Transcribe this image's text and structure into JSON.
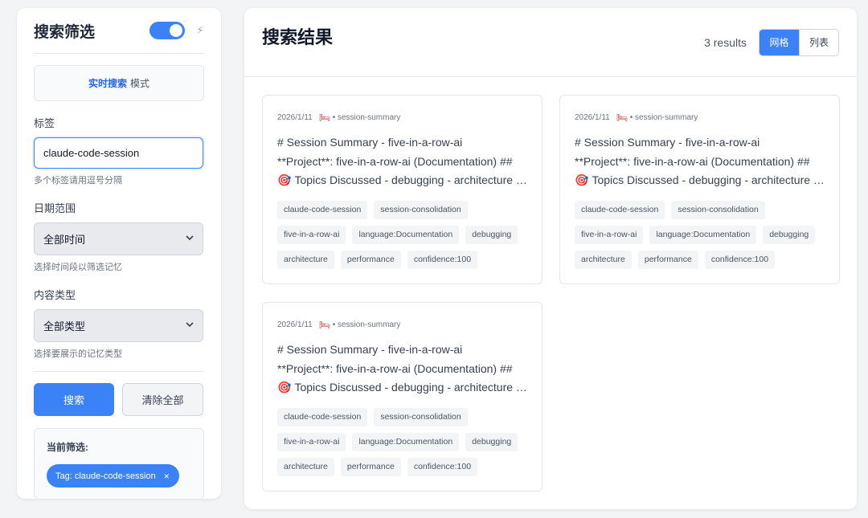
{
  "sidebar": {
    "title": "搜索筛选",
    "mode": {
      "highlight": "实时搜索",
      "suffix": "模式"
    },
    "tags": {
      "label": "标签",
      "value": "claude-code-session",
      "hint": "多个标签请用逗号分隔"
    },
    "date_range": {
      "label": "日期范围",
      "selected": "全部时间",
      "hint": "选择时间段以筛选记忆"
    },
    "content_type": {
      "label": "内容类型",
      "selected": "全部类型",
      "hint": "选择要展示的记忆类型"
    },
    "search_label": "搜索",
    "clear_label": "清除全部",
    "current_filters": {
      "title": "当前筛选:",
      "chip": "Tag: claude-code-session",
      "remove": "×"
    }
  },
  "main": {
    "title": "搜索结果",
    "results_count": "3 results",
    "view": {
      "grid": "网格",
      "list": "列表"
    },
    "cards": [
      {
        "date": "2026/1/11",
        "type": "• session-summary",
        "line1": "# Session Summary - five-in-a-row-ai",
        "line2": "**Project**: five-in-a-row-ai (Documentation) ##",
        "line3": "Topics Discussed - debugging - architecture - performance",
        "tags": [
          "claude-code-session",
          "session-consolidation",
          "five-in-a-row-ai",
          "language:Documentation",
          "debugging",
          "architecture",
          "performance",
          "confidence:100"
        ]
      },
      {
        "date": "2026/1/11",
        "type": "• session-summary",
        "line1": "# Session Summary - five-in-a-row-ai",
        "line2": "**Project**: five-in-a-row-ai (Documentation) ##",
        "line3": "Topics Discussed - debugging - architecture - performance",
        "tags": [
          "claude-code-session",
          "session-consolidation",
          "five-in-a-row-ai",
          "language:Documentation",
          "debugging",
          "architecture",
          "performance",
          "confidence:100"
        ]
      },
      {
        "date": "2026/1/11",
        "type": "• session-summary",
        "line1": "# Session Summary - five-in-a-row-ai",
        "line2": "**Project**: five-in-a-row-ai (Documentation) ##",
        "line3": "Topics Discussed - debugging - architecture - performance",
        "tags": [
          "claude-code-session",
          "session-consolidation",
          "five-in-a-row-ai",
          "language:Documentation",
          "debugging",
          "architecture",
          "performance",
          "confidence:100"
        ]
      }
    ]
  },
  "icons": {
    "bolt": "⚡",
    "bed": "🛏",
    "target": "🎯",
    "chevron": "⌄"
  },
  "colors": {
    "accent": "#3b82f6"
  }
}
